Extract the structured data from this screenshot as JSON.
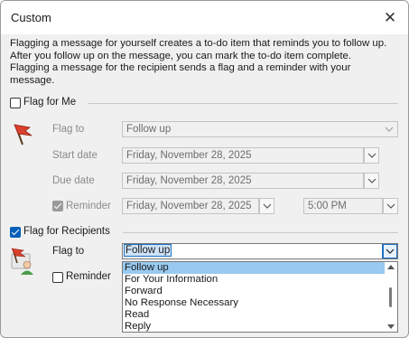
{
  "window": {
    "title": "Custom",
    "close_label": "✕"
  },
  "description": [
    "Flagging a message for yourself creates a to-do item that reminds you to follow up.",
    "After you follow up on the message, you can mark the to-do item complete.",
    "Flagging a message for the recipient sends a flag and a reminder with your",
    "message."
  ],
  "flag_for_me": {
    "label": "Flag for Me",
    "checked": false,
    "flag_to_label": "Flag to",
    "flag_to_value": "Follow up",
    "start_date_label": "Start date",
    "start_date_value": "Friday, November 28, 2025",
    "due_date_label": "Due date",
    "due_date_value": "Friday, November 28, 2025",
    "reminder_label": "Reminder",
    "reminder_checked": true,
    "reminder_date_value": "Friday, November 28, 2025",
    "reminder_time_value": "5:00 PM"
  },
  "flag_for_recipients": {
    "label": "Flag for Recipients",
    "checked": true,
    "flag_to_label": "Flag to",
    "flag_to_value": "Follow up",
    "reminder_label": "Reminder",
    "reminder_checked": false,
    "options": [
      "Follow up",
      "For Your Information",
      "Forward",
      "No Response Necessary",
      "Read",
      "Reply"
    ],
    "highlighted_option": "Follow up"
  },
  "colors": {
    "accent": "#005fb8",
    "highlight": "#99c9ef",
    "flag": "#d9402b"
  }
}
